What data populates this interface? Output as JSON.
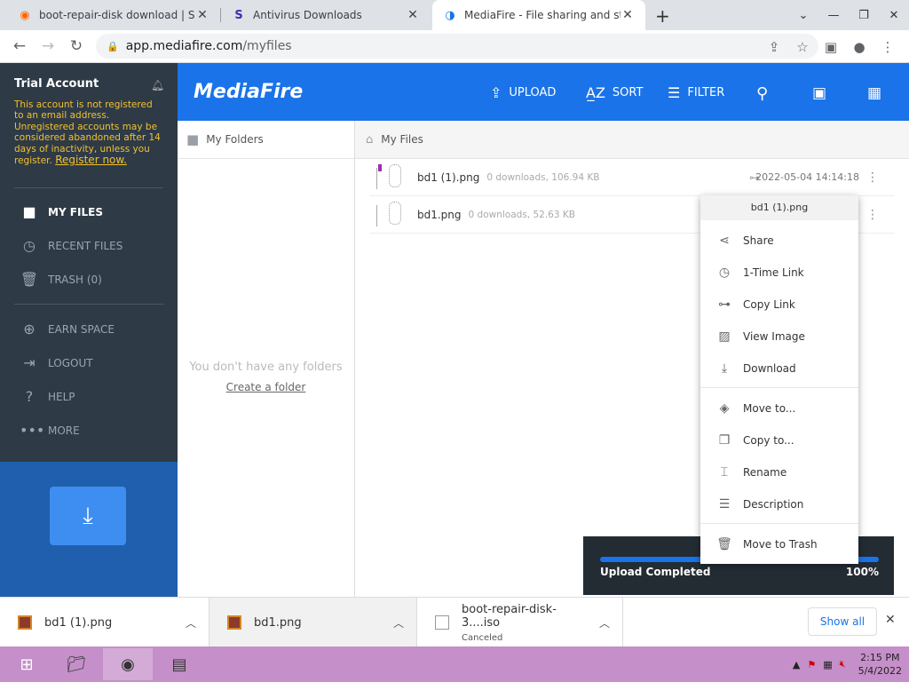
{
  "browser": {
    "tabs": [
      {
        "title": "boot-repair-disk download | Sou",
        "active": false
      },
      {
        "title": "Antivirus Downloads",
        "active": false
      },
      {
        "title": "MediaFire - File sharing and stor",
        "active": true
      }
    ],
    "url_host": "app.mediafire.com",
    "url_path": "/myfiles"
  },
  "sidebar": {
    "account_title": "Trial Account",
    "warning_text": "This account is not registered to an email address. Unregistered accounts may be considered abandoned after 14 days of inactivity, unless you register.",
    "register_link": "Register now.",
    "items": [
      {
        "label": "MY FILES",
        "icon": "folder-icon"
      },
      {
        "label": "RECENT FILES",
        "icon": "clock-icon"
      },
      {
        "label": "TRASH (0)",
        "icon": "trash-icon"
      },
      {
        "label": "EARN SPACE",
        "icon": "plus-circle-icon"
      },
      {
        "label": "LOGOUT",
        "icon": "logout-icon"
      },
      {
        "label": "HELP",
        "icon": "help-icon"
      },
      {
        "label": "MORE",
        "icon": "more-icon"
      }
    ]
  },
  "header": {
    "logo": "MediaFire",
    "upload": "UPLOAD",
    "sort": "SORT",
    "filter": "FILTER"
  },
  "folders": {
    "title": "My Folders",
    "empty_text": "You don't have any folders",
    "create_link": "Create a folder"
  },
  "files": {
    "title": "My Files",
    "rows": [
      {
        "name": "bd1 (1).png",
        "meta": "0 downloads, 106.94 KB",
        "date": "2022-05-04 14:14:18"
      },
      {
        "name": "bd1.png",
        "meta": "0 downloads, 52.63 KB",
        "date": ""
      }
    ]
  },
  "context_menu": {
    "title": "bd1 (1).png",
    "items": [
      {
        "label": "Share",
        "icon": "share-icon"
      },
      {
        "label": "1-Time Link",
        "icon": "clock-icon"
      },
      {
        "label": "Copy Link",
        "icon": "link-icon"
      },
      {
        "label": "View Image",
        "icon": "image-icon"
      },
      {
        "label": "Download",
        "icon": "download-icon"
      },
      {
        "label": "Move to...",
        "icon": "move-icon"
      },
      {
        "label": "Copy to...",
        "icon": "copy-icon"
      },
      {
        "label": "Rename",
        "icon": "rename-icon"
      },
      {
        "label": "Description",
        "icon": "list-icon"
      },
      {
        "label": "Move to Trash",
        "icon": "trash-icon"
      }
    ]
  },
  "upload_toast": {
    "label": "Upload Completed",
    "percent": "100%",
    "progress": 1.0
  },
  "downloads": {
    "items": [
      {
        "name": "bd1 (1).png",
        "status": ""
      },
      {
        "name": "bd1.png",
        "status": ""
      },
      {
        "name": "boot-repair-disk-3....iso",
        "status": "Canceled"
      }
    ],
    "show_all": "Show all"
  },
  "taskbar": {
    "time": "2:15 PM",
    "date": "5/4/2022"
  },
  "colors": {
    "accent": "#1a73e8",
    "sidebar": "#2e3a46",
    "warning": "#f2c12e",
    "taskbar": "#c58fc9"
  }
}
